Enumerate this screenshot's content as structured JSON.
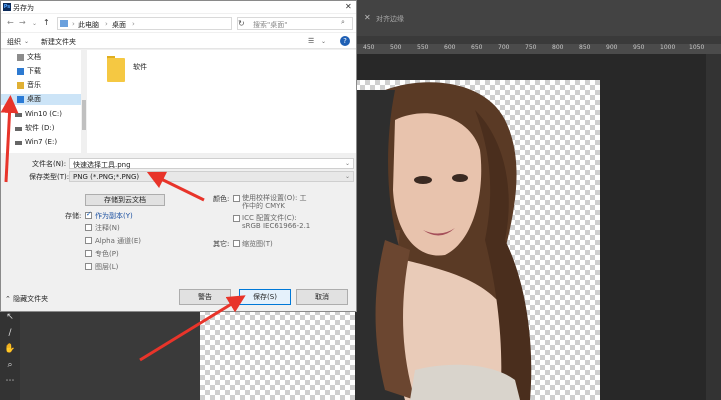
{
  "dialog": {
    "title": "另存为",
    "app_icon": "Ps",
    "close": "✕"
  },
  "address": {
    "crumbs": [
      "此电脑",
      "桌面"
    ],
    "search_placeholder": "搜索\"桌面\""
  },
  "toolbar": {
    "organize": "组织",
    "new_folder": "新建文件夹"
  },
  "nav": {
    "items": [
      {
        "label": "文档",
        "icon": "document-icon"
      },
      {
        "label": "下载",
        "icon": "download-icon"
      },
      {
        "label": "音乐",
        "icon": "music-icon"
      },
      {
        "label": "桌面",
        "icon": "desktop-icon",
        "selected": true
      },
      {
        "label": "Win10 (C:)",
        "icon": "drive-icon"
      },
      {
        "label": "软件 (D:)",
        "icon": "drive-icon"
      },
      {
        "label": "Win7 (E:)",
        "icon": "drive-icon"
      }
    ]
  },
  "files": {
    "items": [
      {
        "label": "软件",
        "icon": "folder-icon"
      }
    ]
  },
  "fields": {
    "filename_label": "文件名(N):",
    "filename_value": "快速选择工具.png",
    "filetype_label": "保存类型(T):",
    "filetype_value": "PNG (*.PNG;*.PNG)"
  },
  "options": {
    "cloud_button": "存储到云文档",
    "save_label": "存储:",
    "as_copy": "作为副本(Y)",
    "notes": "注释(N)",
    "alpha": "Alpha 通道(E)",
    "spot": "专色(P)",
    "layers": "图层(L)",
    "color_label": "颜色:",
    "proof_setup": "使用校样设置(O): 工作中的 CMYK",
    "icc_profile": "ICC 配置文件(C): sRGB IEC61966-2.1",
    "other_label": "其它:",
    "thumbnail": "缩览图(T)"
  },
  "bottom": {
    "hide_folders": "隐藏文件夹",
    "warning": "警告",
    "save": "保存(S)",
    "cancel": "取消"
  },
  "ps": {
    "ruler_numbers": [
      "450",
      "500",
      "550",
      "600",
      "650",
      "700",
      "750",
      "800",
      "850",
      "900",
      "950",
      "1000",
      "1050"
    ],
    "menu_hint": "对齐边缘"
  }
}
